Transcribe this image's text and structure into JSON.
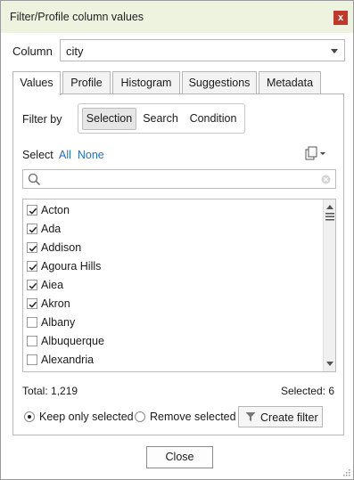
{
  "window": {
    "title": "Filter/Profile column values",
    "close_glyph": "x"
  },
  "column": {
    "label": "Column",
    "value": "city"
  },
  "tabs": [
    {
      "label": "Values",
      "active": true
    },
    {
      "label": "Profile",
      "active": false
    },
    {
      "label": "Histogram",
      "active": false
    },
    {
      "label": "Suggestions",
      "active": false
    },
    {
      "label": "Metadata",
      "active": false
    }
  ],
  "filter_by": {
    "label": "Filter by",
    "options": [
      "Selection",
      "Search",
      "Condition"
    ],
    "selected": "Selection"
  },
  "select_row": {
    "label": "Select",
    "all": "All",
    "none": "None"
  },
  "search": {
    "value": "",
    "placeholder": ""
  },
  "items": [
    {
      "label": "Acton",
      "checked": true
    },
    {
      "label": "Ada",
      "checked": true
    },
    {
      "label": "Addison",
      "checked": true
    },
    {
      "label": "Agoura Hills",
      "checked": true
    },
    {
      "label": "Aiea",
      "checked": true
    },
    {
      "label": "Akron",
      "checked": true
    },
    {
      "label": "Albany",
      "checked": false
    },
    {
      "label": "Albuquerque",
      "checked": false
    },
    {
      "label": "Alexandria",
      "checked": false
    }
  ],
  "totals": {
    "total": "Total: 1,219",
    "selected": "Selected: 6"
  },
  "mode": {
    "keep_label": "Keep only selected",
    "remove_label": "Remove selected",
    "selected": "keep"
  },
  "buttons": {
    "create_filter": "Create filter",
    "close": "Close"
  },
  "colors": {
    "titlebar": "#eef3df",
    "close_button": "#c0392b",
    "link": "#1e6fd0"
  },
  "icons": [
    "close-icon",
    "dropdown-arrow-icon",
    "copy-icon",
    "search-icon",
    "clear-search-icon",
    "checkbox-check-icon",
    "scroll-up-icon",
    "scroll-down-icon",
    "scrollbar-grip-icon",
    "filter-funnel-icon",
    "resize-grip-icon"
  ]
}
